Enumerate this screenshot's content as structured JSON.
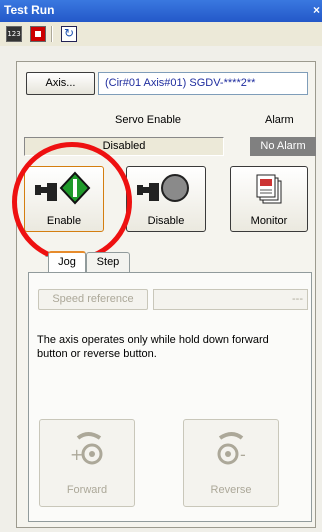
{
  "window": {
    "title": "Test Run",
    "close_glyph": "×"
  },
  "toolbar": {
    "items": [
      {
        "icon": "calendar-icon"
      },
      {
        "icon": "stop-icon"
      },
      {
        "icon": "refresh-icon"
      }
    ]
  },
  "axis": {
    "button_label": "Axis...",
    "value": "(Cir#01 Axis#01) SGDV-****2**"
  },
  "status": {
    "servo_label": "Servo Enable",
    "servo_value": "Disabled",
    "alarm_label": "Alarm",
    "alarm_value": "No Alarm"
  },
  "actions": {
    "enable_label": "Enable",
    "disable_label": "Disable",
    "monitor_label": "Monitor"
  },
  "tabs": [
    {
      "label": "Jog",
      "active": true
    },
    {
      "label": "Step",
      "active": false
    }
  ],
  "jog": {
    "speed_button_label": "Speed reference",
    "speed_value": "---",
    "info_text": "The axis operates only while hold down forward button or reverse button.",
    "forward_label": "Forward",
    "reverse_label": "Reverse"
  },
  "colors": {
    "highlight_circle": "#ee1111",
    "alarm_bg": "#808080",
    "title_bar": "#2a5ed0"
  }
}
